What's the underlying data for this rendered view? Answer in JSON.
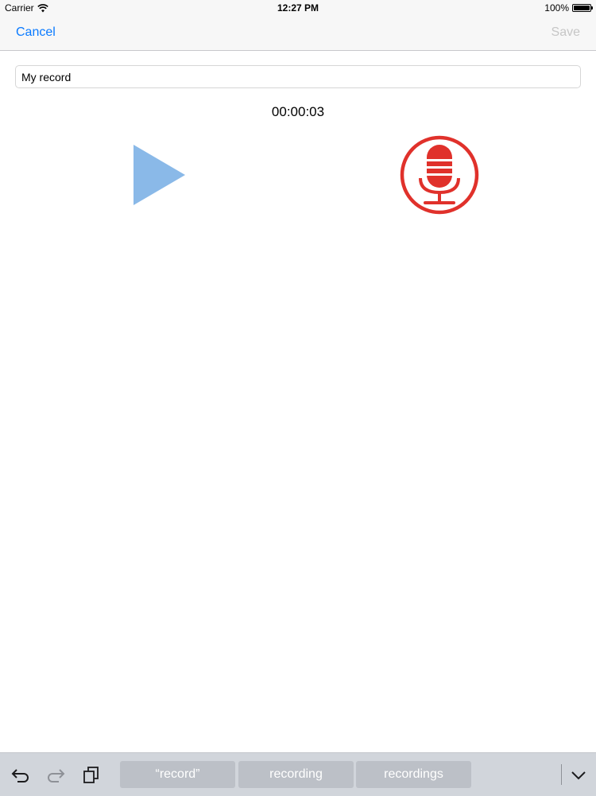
{
  "status_bar": {
    "carrier": "Carrier",
    "time": "12:27 PM",
    "battery_percent": "100%",
    "battery_level": 1.0,
    "wifi_icon": "wifi-icon",
    "battery_icon": "battery-icon"
  },
  "nav": {
    "cancel_label": "Cancel",
    "save_label": "Save"
  },
  "recording": {
    "name_value": "My record",
    "elapsed": "00:00:03",
    "play_icon": "play-icon",
    "record_icon": "microphone-icon"
  },
  "shortcuts": {
    "tools": [
      "undo-icon",
      "redo-icon",
      "paste-icon"
    ],
    "suggestions": [
      "“record”",
      "recording",
      "recordings"
    ],
    "dismiss_icon": "chevron-down-icon"
  },
  "colors": {
    "accent": "#0a7aff",
    "disabled": "#c6c6c6",
    "play": "#8ab9e8",
    "record": "#e0312b",
    "toolbar_bg": "#d1d5db",
    "suggestion_bg": "#bcc0c7"
  }
}
